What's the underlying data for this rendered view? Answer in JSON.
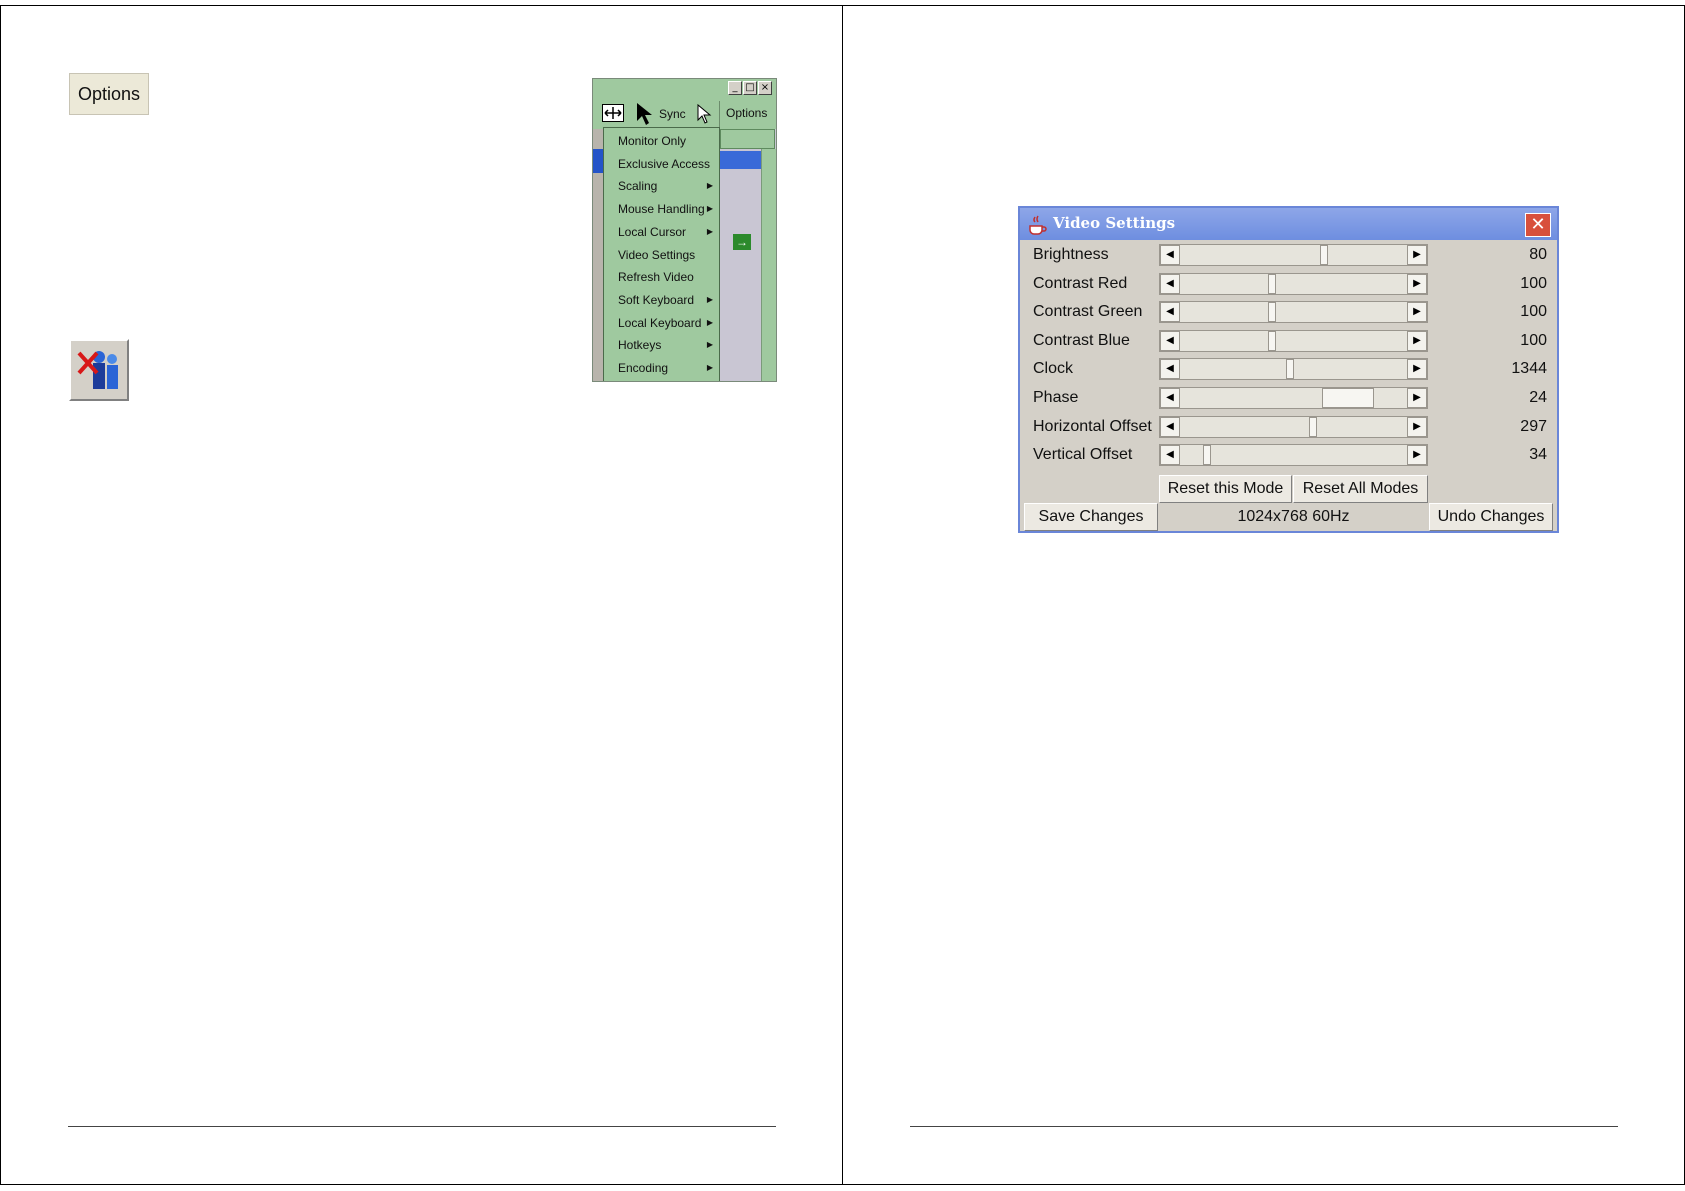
{
  "left_page": {
    "options_button_label": "Options",
    "exit_icon_name": "user-exit-icon",
    "menu_screenshot": {
      "toolbar": {
        "sync_label": "Sync",
        "options_label": "Options"
      },
      "menu_items": [
        {
          "label": "Monitor Only",
          "submenu": false
        },
        {
          "label": "Exclusive Access",
          "submenu": false
        },
        {
          "label": "Scaling",
          "submenu": true
        },
        {
          "label": "Mouse Handling",
          "submenu": true
        },
        {
          "label": "Local Cursor",
          "submenu": true
        },
        {
          "label": "Video Settings",
          "submenu": false
        },
        {
          "label": "Refresh Video",
          "submenu": false
        },
        {
          "label": "Soft Keyboard",
          "submenu": true
        },
        {
          "label": "Local Keyboard",
          "submenu": true
        },
        {
          "label": "Hotkeys",
          "submenu": true
        },
        {
          "label": "Encoding",
          "submenu": true
        }
      ]
    }
  },
  "right_page": {
    "dialog": {
      "title": "Video Settings",
      "settings": [
        {
          "label": "Brightness",
          "value": "80",
          "thumb_fraction": 0.63
        },
        {
          "label": "Contrast Red",
          "value": "100",
          "thumb_fraction": 0.4
        },
        {
          "label": "Contrast Green",
          "value": "100",
          "thumb_fraction": 0.4
        },
        {
          "label": "Contrast Blue",
          "value": "100",
          "thumb_fraction": 0.4
        },
        {
          "label": "Clock",
          "value": "1344",
          "thumb_fraction": 0.48
        },
        {
          "label": "Phase",
          "value": "24",
          "thumb_fraction": 0.62,
          "wide_thumb": true
        },
        {
          "label": "Horizontal Offset",
          "value": "297",
          "thumb_fraction": 0.58
        },
        {
          "label": "Vertical Offset",
          "value": "34",
          "thumb_fraction": 0.12
        }
      ],
      "reset_mode_label": "Reset this Mode",
      "reset_all_label": "Reset All Modes",
      "save_label": "Save Changes",
      "resolution": "1024x768 60Hz",
      "undo_label": "Undo Changes"
    }
  },
  "colors": {
    "menu_green": "#9fc99f",
    "title_blue": "#7a96e4",
    "close_red": "#d8503c"
  }
}
